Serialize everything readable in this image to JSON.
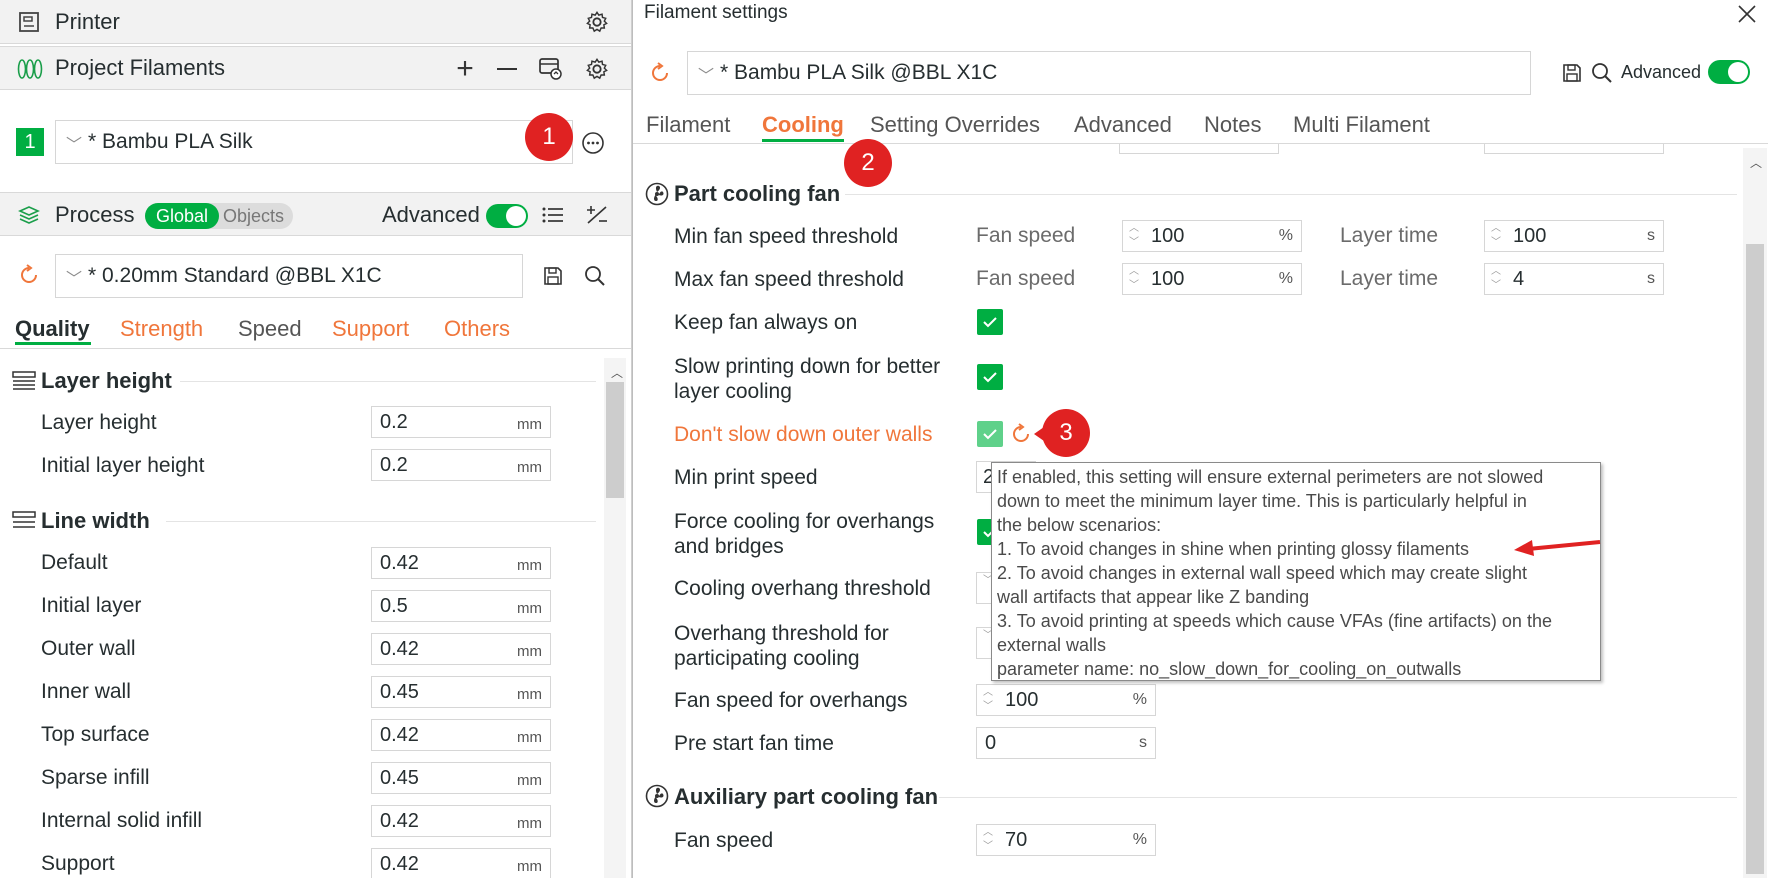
{
  "left": {
    "printer": {
      "title": "Printer"
    },
    "filaments": {
      "title": "Project Filaments",
      "slot_number": "1",
      "selected": "* Bambu PLA Silk"
    },
    "process": {
      "title": "Process",
      "toggle_global": "Global",
      "toggle_objects": "Objects",
      "advanced_label": "Advanced",
      "preset": "* 0.20mm Standard @BBL X1C"
    },
    "tabs": [
      "Quality",
      "Strength",
      "Speed",
      "Support",
      "Others"
    ],
    "layer_height_section": {
      "title": "Layer height",
      "rows": [
        {
          "label": "Layer height",
          "value": "0.2",
          "unit": "mm"
        },
        {
          "label": "Initial layer height",
          "value": "0.2",
          "unit": "mm"
        }
      ]
    },
    "line_width_section": {
      "title": "Line width",
      "rows": [
        {
          "label": "Default",
          "value": "0.42",
          "unit": "mm"
        },
        {
          "label": "Initial layer",
          "value": "0.5",
          "unit": "mm"
        },
        {
          "label": "Outer wall",
          "value": "0.42",
          "unit": "mm"
        },
        {
          "label": "Inner wall",
          "value": "0.45",
          "unit": "mm"
        },
        {
          "label": "Top surface",
          "value": "0.42",
          "unit": "mm"
        },
        {
          "label": "Sparse infill",
          "value": "0.45",
          "unit": "mm"
        },
        {
          "label": "Internal solid infill",
          "value": "0.42",
          "unit": "mm"
        },
        {
          "label": "Support",
          "value": "0.42",
          "unit": "mm"
        }
      ]
    }
  },
  "right": {
    "window_title": "Filament settings",
    "preset": "* Bambu PLA Silk @BBL X1C",
    "advanced_label": "Advanced",
    "tabs": [
      "Filament",
      "Cooling",
      "Setting Overrides",
      "Advanced",
      "Notes",
      "Multi Filament"
    ],
    "part_cooling": {
      "title": "Part cooling fan",
      "min_fan": {
        "label": "Min fan speed threshold",
        "fan_label": "Fan speed",
        "fan_value": "100",
        "fan_unit": "%",
        "time_label": "Layer time",
        "time_value": "100",
        "time_unit": "s"
      },
      "max_fan": {
        "label": "Max fan speed threshold",
        "fan_label": "Fan speed",
        "fan_value": "100",
        "fan_unit": "%",
        "time_label": "Layer time",
        "time_value": "4",
        "time_unit": "s"
      },
      "keep_fan_on": {
        "label": "Keep fan always on"
      },
      "slow_down": {
        "label_line1": "Slow printing down for better",
        "label_line2": "layer cooling"
      },
      "dont_slow_outer": {
        "label": "Don't slow down outer walls"
      },
      "min_print_speed": {
        "label": "Min print speed",
        "value_partial": "2"
      },
      "force_cooling": {
        "label_line1": "Force cooling for overhangs",
        "label_line2": "and bridges"
      },
      "cooling_overhang": {
        "label": "Cooling overhang threshold"
      },
      "overhang_threshold": {
        "label_line1": "Overhang threshold for",
        "label_line2": "participating cooling"
      },
      "fan_speed_overhangs": {
        "label": "Fan speed for overhangs",
        "value": "100",
        "unit": "%"
      },
      "pre_start_fan": {
        "label": "Pre start fan time",
        "value": "0",
        "unit": "s"
      }
    },
    "aux_cooling": {
      "title": "Auxiliary part cooling fan",
      "fan_speed": {
        "label": "Fan speed",
        "value": "70",
        "unit": "%"
      }
    },
    "tooltip": {
      "lines": [
        "If enabled, this setting will ensure external perimeters are not slowed",
        "down to meet the minimum layer time. This is particularly helpful in",
        "the below scenarios:",
        "1. To avoid changes in shine when printing glossy filaments",
        "2. To avoid changes in external wall speed which may create slight",
        "wall artifacts that appear like Z banding",
        "3. To avoid printing at speeds which cause VFAs (fine artifacts) on the",
        "external walls",
        "parameter name: no_slow_down_for_cooling_on_outwalls"
      ]
    }
  },
  "badges": [
    "1",
    "2",
    "3"
  ],
  "colors": {
    "accent_orange": "#f0763b",
    "accent_green": "#00ae42",
    "annotation_red": "#e02222",
    "modified_text": "#f0763b"
  },
  "icons": [
    "printer-icon",
    "gear-icon",
    "filament-icon",
    "plus-icon",
    "minus-icon",
    "sync-icon",
    "process-icon",
    "list-icon",
    "compare-icon",
    "reset-icon",
    "save-icon",
    "search-icon",
    "more-icon",
    "close-icon",
    "fan-icon",
    "layers-icon",
    "line-width-icon"
  ]
}
